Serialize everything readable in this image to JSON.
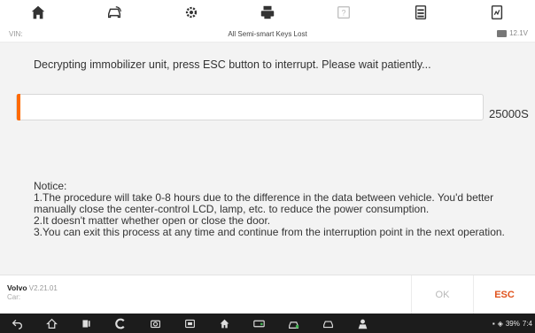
{
  "toolbar": {
    "items": [
      "home-icon",
      "vehicle-swap-icon",
      "settings-icon",
      "print-icon",
      "help-icon",
      "data-log-icon",
      "report-icon"
    ]
  },
  "titlebar": {
    "vin_label": "VIN:",
    "title": "All Semi-smart Keys Lost",
    "battery_voltage": "12.1V"
  },
  "main": {
    "message": "Decrypting immobilizer unit, press  ESC  button to interrupt. Please wait patiently...",
    "progress": {
      "fraction": 0.008,
      "readout": "25000S"
    },
    "notice": {
      "title": "Notice:",
      "lines": [
        "1.The procedure will take 0-8 hours due to the difference in the data between vehicle. You'd better manually close the center-control LCD, lamp, etc. to reduce the power consumption.",
        "2.It doesn't matter whether open or close the door.",
        "3.You can exit this process at any time and continue from the interruption point in the next operation."
      ]
    }
  },
  "footer": {
    "vehicle_make": "Volvo",
    "vehicle_version": "V2.21.01",
    "vehicle_car": "Car:",
    "ok_label": "OK",
    "esc_label": "ESC"
  },
  "navbar": {
    "icons": [
      "back-icon",
      "home-nav-icon",
      "recent-apps-icon",
      "browser-icon",
      "camera-icon",
      "vci-icon",
      "home-app-icon",
      "battery-test-icon",
      "vehicle-app-icon",
      "car-icon",
      "mechanic-icon"
    ],
    "status": {
      "battery": "39%",
      "time": "7:4"
    }
  },
  "colors": {
    "accent": "#ff6a00",
    "esc_text": "#e0531d",
    "content_bg": "#f3f3f3",
    "navbar_bg": "#1c1c1c"
  }
}
